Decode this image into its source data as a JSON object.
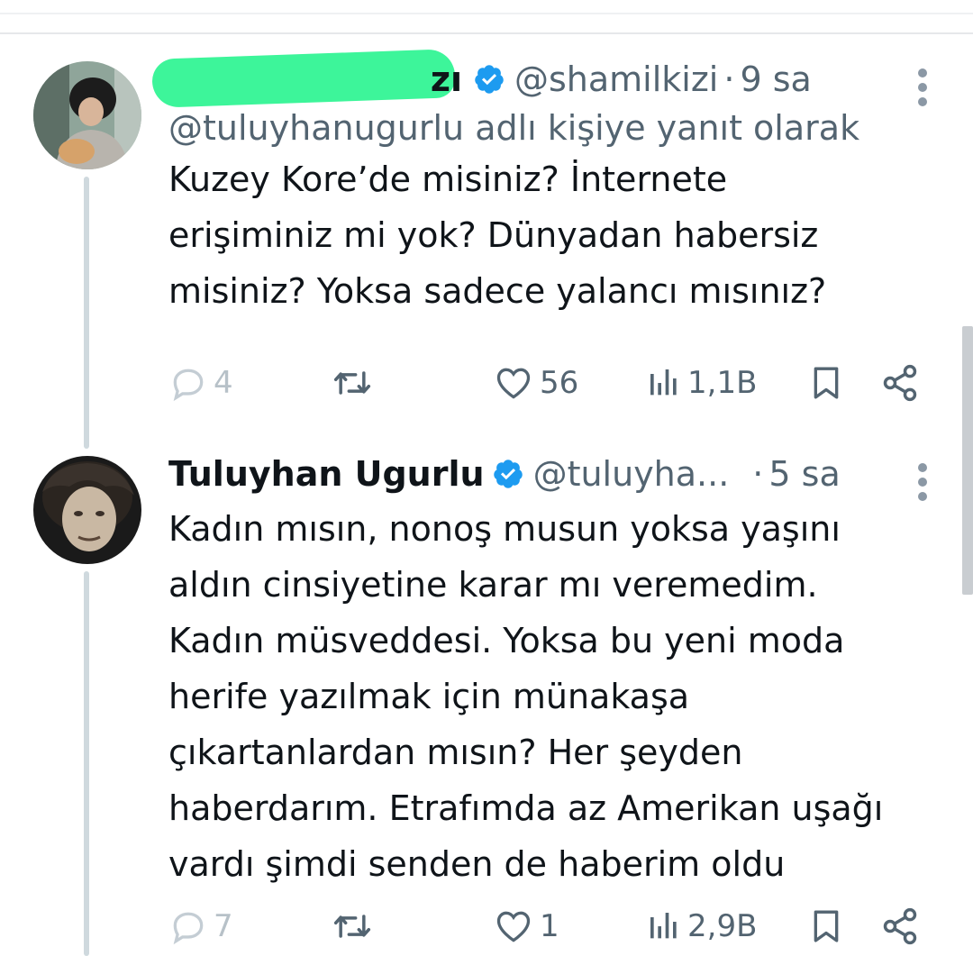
{
  "tweets": [
    {
      "name_visible_suffix": "zı",
      "handle": "@shamilkizi",
      "dot": "·",
      "time": "9 sa",
      "reply_to": "@tuluyhanugurlu adlı kişiye yanıt olarak",
      "text_lines": [
        "Kuzey Kore’de misiniz? İnternete",
        "erişiminiz mi yok? Dünyadan habersiz",
        "misiniz? Yoksa sadece yalancı mısınız?"
      ],
      "replies": "4",
      "retweets": "",
      "likes": "56",
      "views": "1,1B"
    },
    {
      "name": "Tuluyhan Ugurlu",
      "handle": "@tuluyha...",
      "dot": "·",
      "time": "5 sa",
      "text_lines": [
        "Kadın mısın, nonoş musun yoksa yaşını",
        "aldın cinsiyetine karar mı veremedim.",
        "Kadın müsveddesi. Yoksa bu yeni moda",
        "herife yazılmak için münakaşa",
        "çıkartanlardan mısın? Her şeyden",
        "haberdarım. Etrafımda az Amerikan uşağı",
        "vardı şimdi senden de haberim oldu"
      ],
      "replies": "7",
      "retweets": "",
      "likes": "1",
      "views": "2,9B"
    }
  ],
  "icons": {
    "reply": "reply-icon",
    "retweet": "retweet-icon",
    "like": "heart-icon",
    "views": "views-icon",
    "bookmark": "bookmark-icon",
    "share": "share-icon",
    "verified": "verified-badge-icon",
    "more": "more-options-icon"
  },
  "colors": {
    "verified": "#1d9bf0",
    "secondary_text": "#536471",
    "redaction": "#3df59a"
  }
}
